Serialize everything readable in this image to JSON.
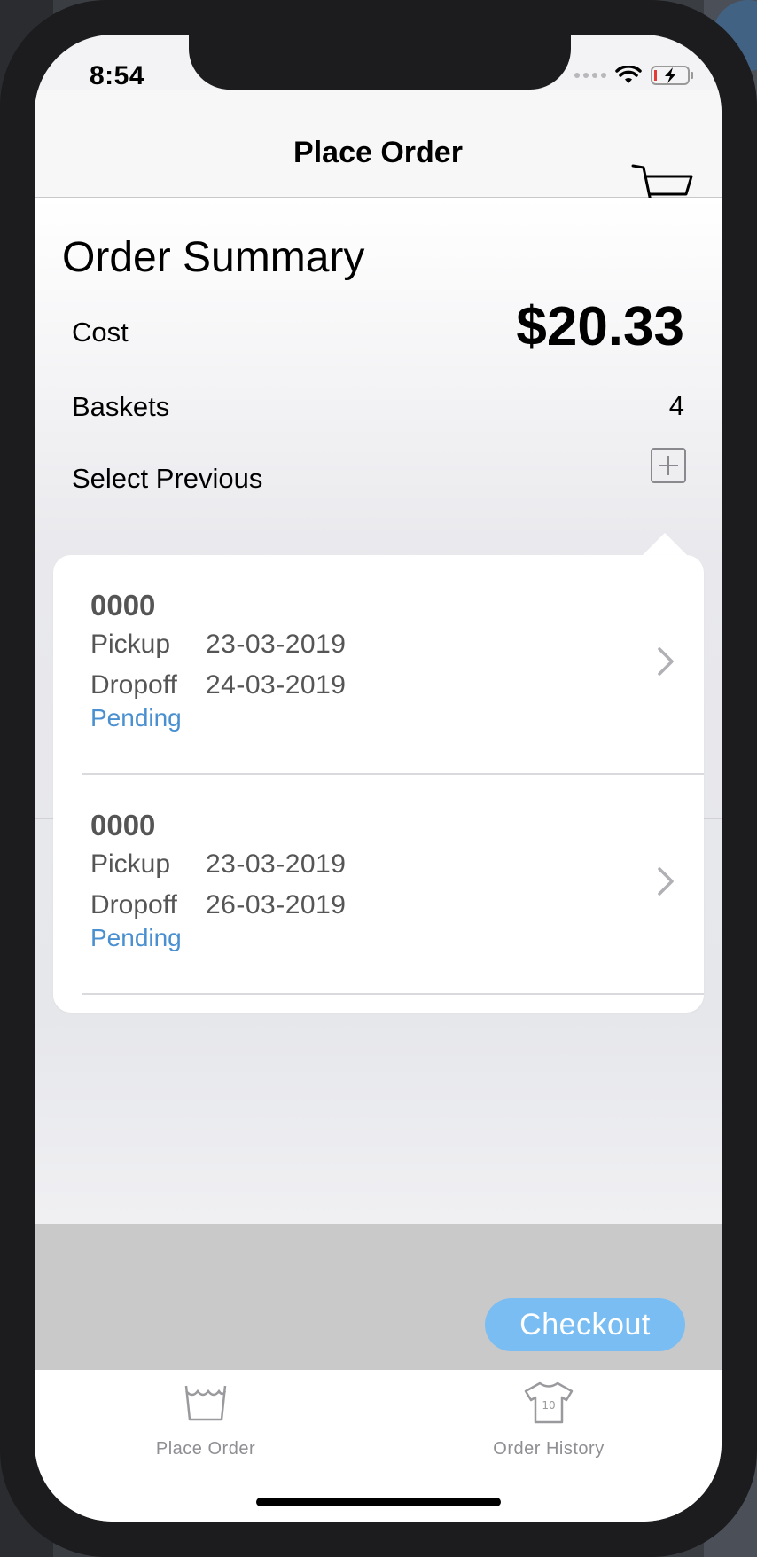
{
  "status_bar": {
    "time": "8:54"
  },
  "nav": {
    "title": "Place Order",
    "cart_icon": "cart-icon"
  },
  "summary": {
    "title": "Order Summary",
    "cost_label": "Cost",
    "cost_value": "$20.33",
    "baskets_label": "Baskets",
    "baskets_value": "4",
    "select_previous_label": "Select Previous"
  },
  "previous_orders": [
    {
      "id": "0000",
      "pickup_label": "Pickup",
      "pickup_date": "23-03-2019",
      "dropoff_label": "Dropoff",
      "dropoff_date": "24-03-2019",
      "status": "Pending"
    },
    {
      "id": "0000",
      "pickup_label": "Pickup",
      "pickup_date": "23-03-2019",
      "dropoff_label": "Dropoff",
      "dropoff_date": "26-03-2019",
      "status": "Pending"
    }
  ],
  "checkout": {
    "label": "Checkout"
  },
  "tabs": [
    {
      "label": "Place Order",
      "icon": "basket-icon"
    },
    {
      "label": "Order History",
      "icon": "jersey-icon"
    }
  ],
  "colors": {
    "accent": "#4a90d0",
    "checkout_bg": "#79bdf3",
    "footer_bg": "#c9c9c9"
  }
}
